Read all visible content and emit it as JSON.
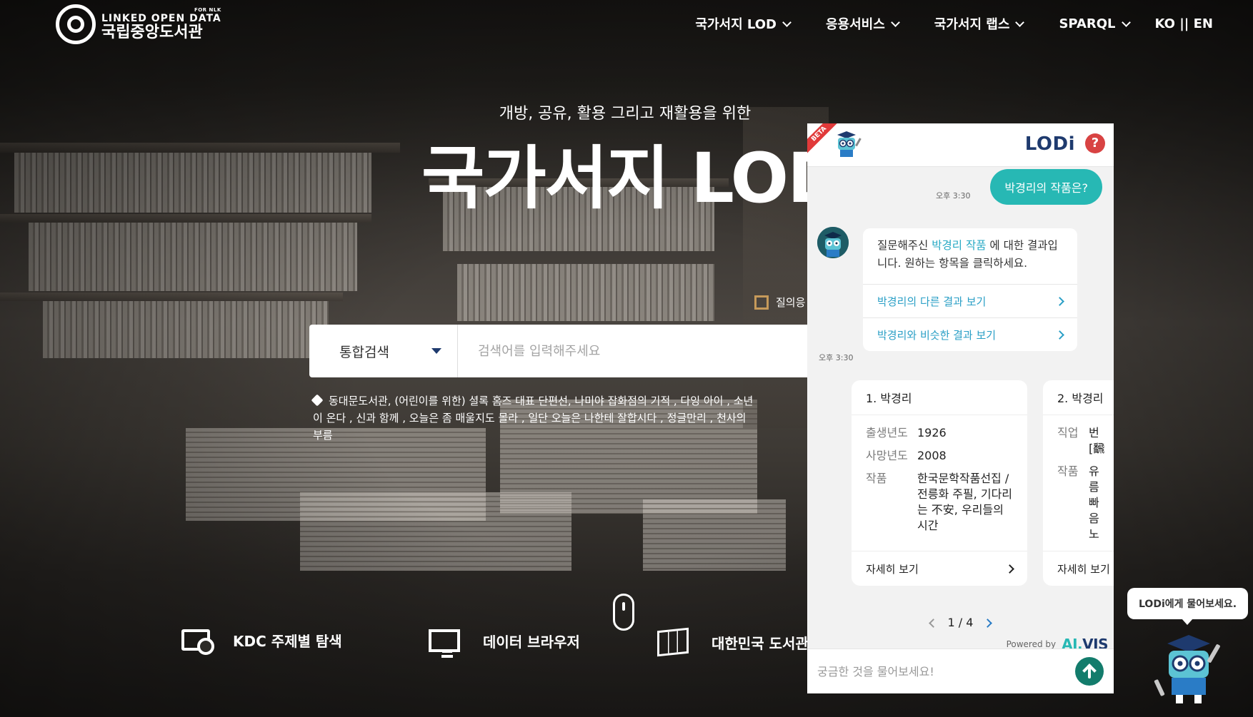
{
  "header": {
    "logo_small": "FOR NLK",
    "logo_en": "LINKED OPEN DATA",
    "logo_ko": "국립중앙도서관",
    "nav": [
      {
        "label": "국가서지 LOD"
      },
      {
        "label": "응용서비스"
      },
      {
        "label": "국가서지 랩스"
      },
      {
        "label": "SPARQL"
      }
    ],
    "lang": "KO || EN"
  },
  "hero": {
    "subtitle": "개방, 공유, 활용 그리고 재활용을 위한",
    "title": "국가서지 LOD"
  },
  "checkbox_label": "질의응",
  "search": {
    "scope": "통합검색",
    "placeholder": "검색어를 입력해주세요"
  },
  "tags": "동대문도서관, (어린이를 위한) 셜록 홈즈 대표 단편선, 나미야 잡화점의 기적 , 다잉 아이 , 소년이 온다 , 신과 함께 , 오늘은 좀 매울지도 몰라 , 일단 오늘은 나한테 잘합시다 , 정글만리 , 천사의 부름",
  "bottom_links": [
    {
      "label": "KDC 주제별 탐색"
    },
    {
      "label": "데이터 브라우저"
    },
    {
      "label": "대한민국 도서관"
    }
  ],
  "chat": {
    "beta": "BETA",
    "title": "LODi",
    "help": "?",
    "user_message": "박경리의 작품은?",
    "user_time": "오후 3:30",
    "bot_text_pre": "질문해주신 ",
    "bot_text_hl": "박경리 작품",
    "bot_text_post": " 에 대한 결과입니다. 원하는 항목을 클릭하세요.",
    "options": [
      {
        "label": "박경리의 다른 결과 보기"
      },
      {
        "label": "박경리와 비슷한 결과 보기"
      }
    ],
    "bot_time": "오후 3:30",
    "cards": [
      {
        "title": "1. 박경리",
        "rows": [
          {
            "key": "출생년도",
            "value": "1926"
          },
          {
            "key": "사망년도",
            "value": "2008"
          },
          {
            "key": "작품",
            "value": "한국문학작품선집 / 전릉화 주필, 기다리는 不安, 우리들의 시간"
          }
        ],
        "more": "자세히 보기"
      },
      {
        "title": "2. 박경리",
        "rows": [
          {
            "key": "직업",
            "value": "번[飜"
          },
          {
            "key": "작품",
            "value": "유름빠음노"
          }
        ],
        "more": "자세히 보기"
      }
    ],
    "pager": "1 / 4",
    "powered_label": "Powered by",
    "powered_brand_a": "AI.",
    "powered_brand_b": "VIS",
    "input_placeholder": "궁금한 것을 물어보세요!"
  },
  "tooltip": "LODi에게 물어보세요.",
  "colors": {
    "accent_teal": "#27b8b4",
    "brand_navy": "#1e3a6e",
    "help_red": "#d84343",
    "send_green": "#137c6c"
  }
}
